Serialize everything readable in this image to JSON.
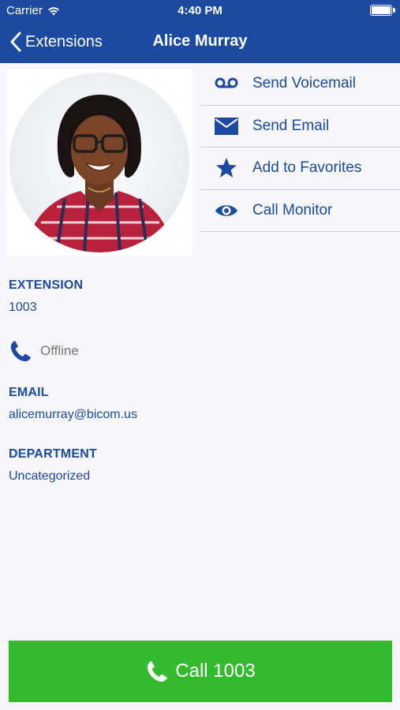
{
  "status_bar": {
    "carrier": "Carrier",
    "time": "4:40 PM"
  },
  "nav": {
    "back_label": "Extensions",
    "title": "Alice Murray"
  },
  "actions": [
    {
      "label": "Send Voicemail",
      "icon": "voicemail-icon"
    },
    {
      "label": "Send Email",
      "icon": "envelope-icon"
    },
    {
      "label": "Add to Favorites",
      "icon": "star-icon"
    },
    {
      "label": "Call Monitor",
      "icon": "eye-icon"
    }
  ],
  "extension": {
    "heading": "EXTENSION",
    "value": "1003"
  },
  "presence": {
    "status": "Offline",
    "icon": "phone-icon"
  },
  "email": {
    "heading": "EMAIL",
    "value": "alicemurray@bicom.us"
  },
  "department": {
    "heading": "DEPARTMENT",
    "value": "Uncategorized"
  },
  "call_button": {
    "label": "Call 1003"
  },
  "colors": {
    "brand": "#1c4aa0",
    "call": "#34ba2e",
    "muted": "#777777"
  }
}
